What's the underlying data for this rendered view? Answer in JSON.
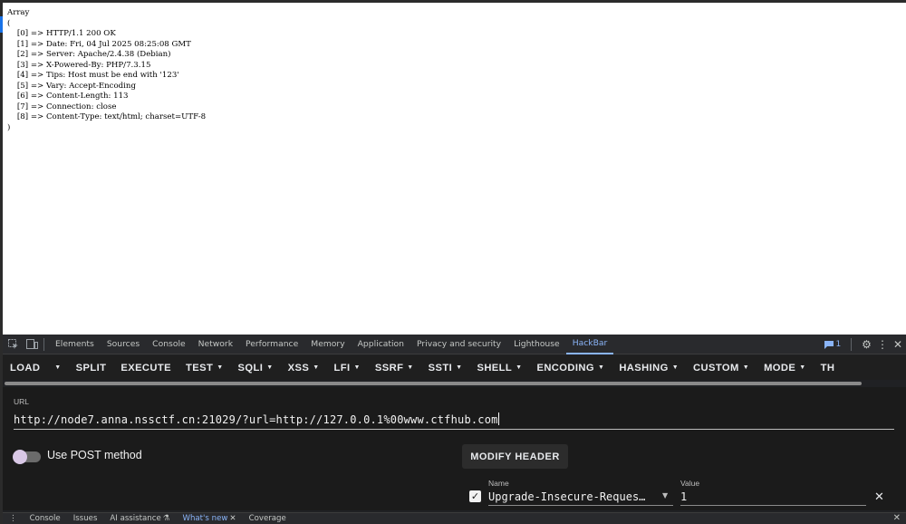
{
  "page": {
    "output_lines": [
      "Array",
      "(",
      "    [0] => HTTP/1.1 200 OK",
      "    [1] => Date: Fri, 04 Jul 2025 08:25:08 GMT",
      "    [2] => Server: Apache/2.4.38 (Debian)",
      "    [3] => X-Powered-By: PHP/7.3.15",
      "    [4] => Tips: Host must be end with '123'",
      "    [5] => Vary: Accept-Encoding",
      "    [6] => Content-Length: 113",
      "    [7] => Connection: close",
      "    [8] => Content-Type: text/html; charset=UTF-8",
      ")"
    ]
  },
  "devtools": {
    "tabs": [
      {
        "label": "Elements",
        "name": "tab-elements"
      },
      {
        "label": "Sources",
        "name": "tab-sources"
      },
      {
        "label": "Console",
        "name": "tab-console"
      },
      {
        "label": "Network",
        "name": "tab-network"
      },
      {
        "label": "Performance",
        "name": "tab-performance"
      },
      {
        "label": "Memory",
        "name": "tab-memory"
      },
      {
        "label": "Application",
        "name": "tab-application"
      },
      {
        "label": "Privacy and security",
        "name": "tab-privacy-security"
      },
      {
        "label": "Lighthouse",
        "name": "tab-lighthouse"
      },
      {
        "label": "HackBar",
        "name": "tab-hackbar",
        "active": true
      }
    ],
    "message_count": "1",
    "drawer_tabs": [
      {
        "label": "Console",
        "name": "drawer-tab-console"
      },
      {
        "label": "Issues",
        "name": "drawer-tab-issues"
      },
      {
        "label": "AI assistance",
        "name": "drawer-tab-ai-assistance",
        "icon": "flask-icon"
      },
      {
        "label": "What's new",
        "name": "drawer-tab-whats-new",
        "active": true,
        "closable": true
      },
      {
        "label": "Coverage",
        "name": "drawer-tab-coverage"
      }
    ],
    "accent": "#8ab4f8"
  },
  "hackbar": {
    "menu": [
      {
        "label": "LOAD",
        "name": "load-button",
        "caret": false
      },
      {
        "label": "",
        "name": "load-dropdown-button",
        "caret": true
      },
      {
        "label": "SPLIT",
        "name": "split-button",
        "caret": false
      },
      {
        "label": "EXECUTE",
        "name": "execute-button",
        "caret": false
      },
      {
        "label": "TEST",
        "name": "test-menu",
        "caret": true
      },
      {
        "label": "SQLI",
        "name": "sqli-menu",
        "caret": true
      },
      {
        "label": "XSS",
        "name": "xss-menu",
        "caret": true
      },
      {
        "label": "LFI",
        "name": "lfi-menu",
        "caret": true
      },
      {
        "label": "SSRF",
        "name": "ssrf-menu",
        "caret": true
      },
      {
        "label": "SSTI",
        "name": "ssti-menu",
        "caret": true
      },
      {
        "label": "SHELL",
        "name": "shell-menu",
        "caret": true
      },
      {
        "label": "ENCODING",
        "name": "encoding-menu",
        "caret": true
      },
      {
        "label": "HASHING",
        "name": "hashing-menu",
        "caret": true
      },
      {
        "label": "CUSTOM",
        "name": "custom-menu",
        "caret": true
      },
      {
        "label": "MODE",
        "name": "mode-menu",
        "caret": true
      },
      {
        "label": "TH",
        "name": "theme-menu",
        "caret": false
      }
    ],
    "url_label": "URL",
    "url_value": "http://node7.anna.nssctf.cn:21029/?url=http://127.0.0.1%00www.ctfhub.com",
    "post_label": "Use POST method",
    "post_enabled": false,
    "modify_header_label": "MODIFY HEADER",
    "header": {
      "enabled": true,
      "name_label": "Name",
      "name_value": "Upgrade-Insecure-Reques…",
      "value_label": "Value",
      "value_value": "1"
    }
  }
}
